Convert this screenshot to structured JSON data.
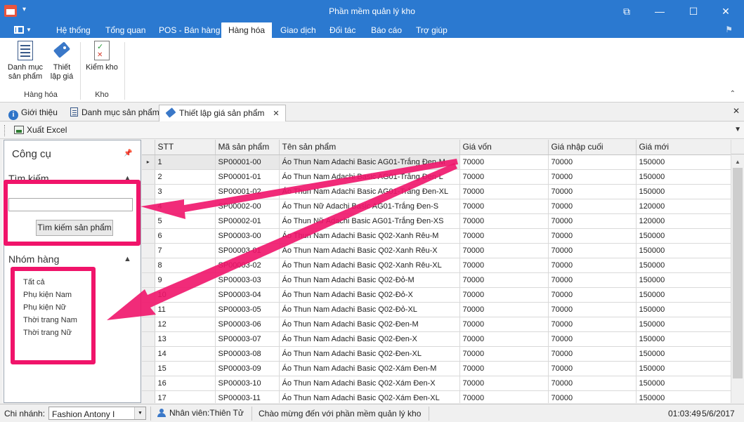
{
  "window": {
    "title": "Phần mềm quản lý kho",
    "quick_access": "▾",
    "controls": [
      "⧉",
      "—",
      "☐",
      "✕"
    ]
  },
  "ribbon_tabs": [
    {
      "label": "Hệ thống"
    },
    {
      "label": "Tổng quan"
    },
    {
      "label": "POS - Bán hàng"
    },
    {
      "label": "Hàng hóa",
      "active": true
    },
    {
      "label": "Giao dịch"
    },
    {
      "label": "Đối tác"
    },
    {
      "label": "Báo cáo"
    },
    {
      "label": "Trợ giúp"
    }
  ],
  "ribbon": {
    "product_catalog": "Danh mục\nsản phẩm",
    "product_catalog_l1": "Danh mục",
    "product_catalog_l2": "sản phẩm",
    "set_price_l1": "Thiết",
    "set_price_l2": "lập giá",
    "inventory_check": "Kiểm kho",
    "group_goods": "Hàng hóa",
    "group_warehouse": "Kho"
  },
  "doc_tabs": [
    {
      "label": "Giới thiệu",
      "icon": "info-icon"
    },
    {
      "label": "Danh mục sản phẩm",
      "icon": "document-icon"
    },
    {
      "label": "Thiết lập giá sản phẩm",
      "icon": "price-tag-icon",
      "active": true
    }
  ],
  "toolbar": {
    "export_label": "Xuất Excel"
  },
  "left_panel": {
    "title": "Công cụ",
    "search_section": "Tìm kiếm",
    "search_value": "",
    "search_button": "Tìm kiếm sản phẩm",
    "group_section": "Nhóm hàng",
    "groups": [
      "Tất cả",
      "Phụ kiện Nam",
      "Phụ kiện Nữ",
      "Thời trang Nam",
      "Thời trang Nữ"
    ]
  },
  "grid": {
    "columns": [
      "STT",
      "Mã sản phẩm",
      "Tên sản phẩm",
      "Giá vốn",
      "Giá nhập cuối",
      "Giá mới"
    ],
    "rows": [
      [
        "1",
        "SP00001-00",
        "Áo Thun Nam Adachi Basic AG01-Trắng Đen-M",
        "70000",
        "70000",
        "150000"
      ],
      [
        "2",
        "SP00001-01",
        "Áo Thun Nam Adachi Basic AG01-Trắng Đen-L",
        "70000",
        "70000",
        "150000"
      ],
      [
        "3",
        "SP00001-02",
        "Áo Thun Nam Adachi Basic AG01-Trắng Đen-XL",
        "70000",
        "70000",
        "150000"
      ],
      [
        "4",
        "SP00002-00",
        "Áo Thun Nữ Adachi Basic AG01-Trắng Đen-S",
        "70000",
        "70000",
        "120000"
      ],
      [
        "5",
        "SP00002-01",
        "Áo Thun Nữ Adachi Basic AG01-Trắng Đen-XS",
        "70000",
        "70000",
        "120000"
      ],
      [
        "6",
        "SP00003-00",
        "Áo Thun Nam Adachi Basic Q02-Xanh Rêu-M",
        "70000",
        "70000",
        "150000"
      ],
      [
        "7",
        "SP00003-01",
        "Áo Thun Nam Adachi Basic Q02-Xanh Rêu-X",
        "70000",
        "70000",
        "150000"
      ],
      [
        "8",
        "SP00003-02",
        "Áo Thun Nam Adachi Basic Q02-Xanh Rêu-XL",
        "70000",
        "70000",
        "150000"
      ],
      [
        "9",
        "SP00003-03",
        "Áo Thun Nam Adachi Basic Q02-Đỏ-M",
        "70000",
        "70000",
        "150000"
      ],
      [
        "10",
        "SP00003-04",
        "Áo Thun Nam Adachi Basic Q02-Đỏ-X",
        "70000",
        "70000",
        "150000"
      ],
      [
        "11",
        "SP00003-05",
        "Áo Thun Nam Adachi Basic Q02-Đỏ-XL",
        "70000",
        "70000",
        "150000"
      ],
      [
        "12",
        "SP00003-06",
        "Áo Thun Nam Adachi Basic Q02-Đen-M",
        "70000",
        "70000",
        "150000"
      ],
      [
        "13",
        "SP00003-07",
        "Áo Thun Nam Adachi Basic Q02-Đen-X",
        "70000",
        "70000",
        "150000"
      ],
      [
        "14",
        "SP00003-08",
        "Áo Thun Nam Adachi Basic Q02-Đen-XL",
        "70000",
        "70000",
        "150000"
      ],
      [
        "15",
        "SP00003-09",
        "Áo Thun Nam Adachi Basic Q02-Xám Đen-M",
        "70000",
        "70000",
        "150000"
      ],
      [
        "16",
        "SP00003-10",
        "Áo Thun Nam Adachi Basic Q02-Xám Đen-X",
        "70000",
        "70000",
        "150000"
      ],
      [
        "17",
        "SP00003-11",
        "Áo Thun Nam Adachi Basic Q02-Xám Đen-XL",
        "70000",
        "70000",
        "150000"
      ]
    ],
    "row_indicator": "▸"
  },
  "status": {
    "branch_label": "Chi nhánh:",
    "branch_value": "Fashion Antony I",
    "employee": "Nhân viên:Thiên Tử",
    "welcome": "Chào mừng đến với phần mềm quản lý kho",
    "time": "01:03:49",
    "date": "5/6/2017"
  },
  "colors": {
    "title_bar": "#2b79d0",
    "annotation": "#f0146a"
  }
}
